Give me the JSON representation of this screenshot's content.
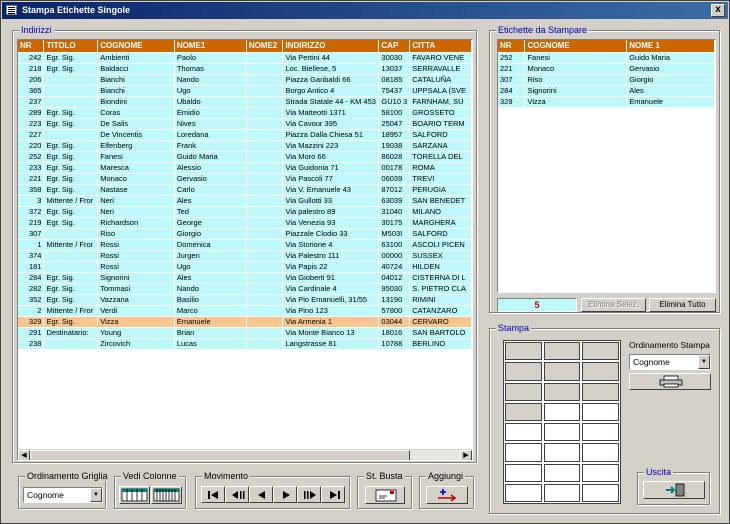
{
  "window": {
    "title": "Stampa Etichette Singole",
    "close_label": "x"
  },
  "indirizzi": {
    "label": "Indirizzi",
    "columns": [
      "NR",
      "TITOLO",
      "COGNOME",
      "NOME1",
      "NOME2",
      "INDIRIZZO",
      "CAP",
      "CITTA"
    ],
    "rows": [
      [
        "242",
        "Egr. Sig.",
        "Ambienti",
        "Paolo",
        "",
        "Via Pertini 44",
        "30030",
        "FAVARO VENE"
      ],
      [
        "218",
        "Egr. Sig.",
        "Baldacci",
        "Thomas",
        "",
        "Loc. Biellese, 5",
        "13037",
        "SERRAVALLE"
      ],
      [
        "206",
        "",
        "Bianchi",
        "Nando",
        "",
        "Piazza Garibaldi 66",
        "08185",
        "CATALUÑA"
      ],
      [
        "365",
        "",
        "Bianchi",
        "Ugo",
        "",
        "Borgo Antico 4",
        "75437",
        "UPPSALA (SVE"
      ],
      [
        "237",
        "",
        "Biondini",
        "Ubaldo",
        "",
        "Strada Statale 44 - KM 453",
        "GU10 3",
        "FARNHAM, SU"
      ],
      [
        "289",
        "Egr. Sig.",
        "Coras",
        "Emidio",
        "",
        "Via Matteotti 1371",
        "58100",
        "GROSSETO"
      ],
      [
        "223",
        "Egr. Sig.",
        "De Salis",
        "Nives",
        "",
        "Via Cavour 395",
        "25047",
        "BOARIO TERM"
      ],
      [
        "227",
        "",
        "De Vincentis",
        "Loredana",
        "",
        "Piazza Dalla Chiesa 51",
        "18957",
        "SALFORD"
      ],
      [
        "220",
        "Egr. Sig.",
        "Elfenberg",
        "Frank",
        "",
        "Via Mazzini 223",
        "19038",
        "SARZANA"
      ],
      [
        "252",
        "Egr. Sig.",
        "Fanesi",
        "Guido Maria",
        "",
        "Via Moro 66",
        "86028",
        "TORELLA DEL"
      ],
      [
        "233",
        "Egr. Sig.",
        "Maresca",
        "Alessio",
        "",
        "Via Guidonia 71",
        "00178",
        "ROMA"
      ],
      [
        "221",
        "Egr. Sig.",
        "Monaco",
        "Gervasio",
        "",
        "Via Pascoli 77",
        "06039",
        "TREVI"
      ],
      [
        "358",
        "Egr. Sig.",
        "Nastase",
        "Carlo",
        "",
        "Via V. Emanuele 43",
        "87012",
        "PERUGIA"
      ],
      [
        "3",
        "Mittente / Fror",
        "Neri",
        "Ales",
        "",
        "Via Gullotti 33",
        "63039",
        "SAN BENEDET"
      ],
      [
        "372",
        "Egr. Sig.",
        "Neri",
        "Ted",
        "",
        "Via palestro 89",
        "31040",
        "MILANO"
      ],
      [
        "219",
        "Egr. Sig.",
        "Richardson",
        "George",
        "",
        "Via Venezia 93",
        "30175",
        "MARGHERA"
      ],
      [
        "307",
        "",
        "Riso",
        "Giorgio",
        "",
        "Piazzale Clodio 33",
        "M503I",
        "SALFORD"
      ],
      [
        "1",
        "Mittente / Fror",
        "Rossi",
        "Domenica",
        "",
        "Via Storione 4",
        "63100",
        "ASCOLI PICEN"
      ],
      [
        "374",
        "",
        "Rossi",
        "Jurgen",
        "",
        "Via Palestro 111",
        "00000",
        "SUSSEX"
      ],
      [
        "181",
        "",
        "Rossi",
        "Ugo",
        "",
        "Via Papis 22",
        "40724",
        "HILDEN"
      ],
      [
        "284",
        "Egr. Sig.",
        "Signorini",
        "Ales",
        "",
        "Via Gioberti 91",
        "04012",
        "CISTERNA DI L"
      ],
      [
        "282",
        "Egr. Sig.",
        "Tommasi",
        "Nando",
        "",
        "Via Cardinale 4",
        "95030",
        "S. PIETRO CLA"
      ],
      [
        "352",
        "Egr. Sig.",
        "Vazzana",
        "Basilio",
        "",
        "Via Pio Emanuelli, 31/55",
        "13190",
        "RIMINI"
      ],
      [
        "2",
        "Mittente / Fror",
        "Verdi",
        "Marco",
        "",
        "Via Pino 123",
        "57800",
        "CATANZARO"
      ],
      [
        "329",
        "Egr. Sig.",
        "Vizza",
        "Emanuele",
        "",
        "Via Armenia 1",
        "03044",
        "CERVARO"
      ],
      [
        "291",
        "Destinatario:",
        "Young",
        "Brian",
        "",
        "Via Monte Bianco 13",
        "18016",
        "SAN BARTOLO"
      ],
      [
        "238",
        "",
        "Zircovich",
        "Lucas",
        "",
        "Langstrasse 81",
        "10788",
        "BERLINO"
      ]
    ],
    "selected_row": 24
  },
  "etichette": {
    "label": "Etichette da Stampare",
    "columns": [
      "NR",
      "COGNOME",
      "NOME 1"
    ],
    "rows": [
      [
        "252",
        "Fanesi",
        "Guido Maria"
      ],
      [
        "221",
        "Monaco",
        "Gervasio"
      ],
      [
        "307",
        "Riso",
        "Giorgio"
      ],
      [
        "284",
        "Signorini",
        "Ales"
      ],
      [
        "329",
        "Vizza",
        "Emanuele"
      ]
    ],
    "count": "5",
    "elimina_selez": "Elimina Selez.",
    "elimina_tutto": "Elimina Tutto"
  },
  "stampa": {
    "label": "Stampa",
    "ordinamento_label": "Ordinamento Stampa",
    "ordinamento_value": "Cognome",
    "sheet_rows": 8,
    "sheet_cols": 3,
    "used_cells": 10
  },
  "uscita": {
    "label": "Uscita"
  },
  "ordinamento_griglia": {
    "label": "Ordinamento Griglia",
    "value": "Cognome"
  },
  "vedi_colonne": {
    "label": "Vedi Colonne"
  },
  "movimento": {
    "label": "Movimento"
  },
  "st_busta": {
    "label": "St. Busta"
  },
  "aggiungi": {
    "label": "Aggiungi"
  },
  "colors": {
    "header": "#cc6600",
    "row": "#bdf8fb",
    "selected": "#f9c58f",
    "title_start": "#0a246a",
    "title_end": "#3a6ea5"
  },
  "icons": {
    "columns_a": "columns-icon",
    "columns_b": "columns-compact-icon",
    "first": "first-record-icon",
    "prev_page": "prev-page-icon",
    "prev": "prev-record-icon",
    "next": "next-record-icon",
    "next_page": "next-page-icon",
    "last": "last-record-icon",
    "envelope": "envelope-icon",
    "add": "add-arrow-icon",
    "printer": "printer-icon",
    "exit": "exit-door-icon"
  }
}
